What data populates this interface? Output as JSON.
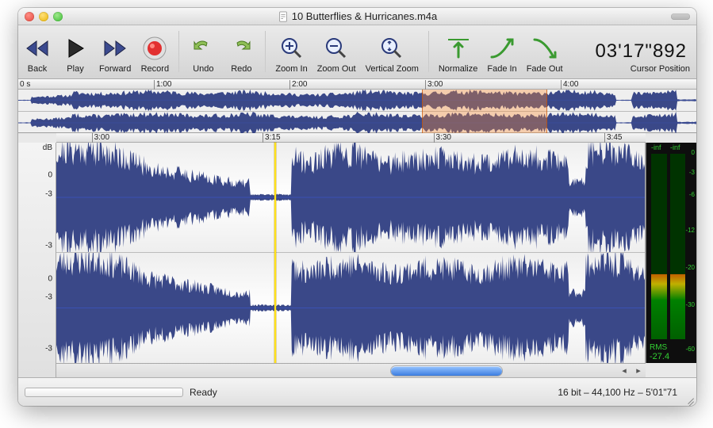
{
  "window": {
    "title": "10 Butterflies & Hurricanes.m4a"
  },
  "toolbar": {
    "back": "Back",
    "play": "Play",
    "forward": "Forward",
    "record": "Record",
    "undo": "Undo",
    "redo": "Redo",
    "zoom_in": "Zoom In",
    "zoom_out": "Zoom Out",
    "vzoom": "Vertical Zoom",
    "normalize": "Normalize",
    "fadein": "Fade In",
    "fadeout": "Fade Out",
    "cursor_pos_label": "Cursor Position",
    "cursor_pos_value": "03'17\"892"
  },
  "overview": {
    "start_label": "0 s",
    "ticks": [
      "1:00",
      "2:00",
      "3:00",
      "4:00"
    ],
    "selection": {
      "left_pct": 59.5,
      "width_pct": 18.5
    }
  },
  "ruler": {
    "ticks": [
      "3:00",
      "3:15",
      "3:30",
      "3:45"
    ]
  },
  "db": {
    "top": [
      "dB",
      "0",
      "-3",
      "-3"
    ],
    "bot": [
      "0",
      "-3",
      "-3"
    ]
  },
  "meter": {
    "inf_l": "-inf",
    "inf_r": "-inf",
    "scale": [
      "0",
      "-3",
      "-6",
      "-12",
      "-20",
      "-30",
      "-60"
    ],
    "rms_label": "RMS",
    "rms_value": "-27.4"
  },
  "playhead_pct": 37.0,
  "status": {
    "ready": "Ready",
    "format": "16 bit – 44,100 Hz – 5'01\"71"
  },
  "colors": {
    "wave": "#2f3e82",
    "midline": "#3b54c2",
    "selection": "#ff9a4a"
  }
}
